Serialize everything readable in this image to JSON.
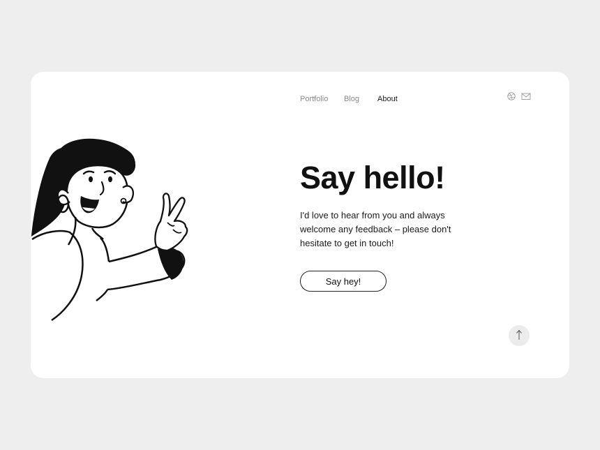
{
  "nav": {
    "items": [
      {
        "label": "Portfolio"
      },
      {
        "label": "Blog"
      },
      {
        "label": "About"
      }
    ]
  },
  "social": {
    "icons": [
      "dribbble-icon",
      "mail-icon"
    ]
  },
  "hero": {
    "title": "Say hello!",
    "body": "I'd love to hear from you and always welcome any feedback – please don't hesitate to get in touch!",
    "cta_label": "Say hey!"
  },
  "colors": {
    "page_background": "#eeeeee",
    "card_background": "#ffffff",
    "text": "#111111",
    "nav_muted": "#8a8a8a",
    "scroll_button": "#ececec"
  }
}
